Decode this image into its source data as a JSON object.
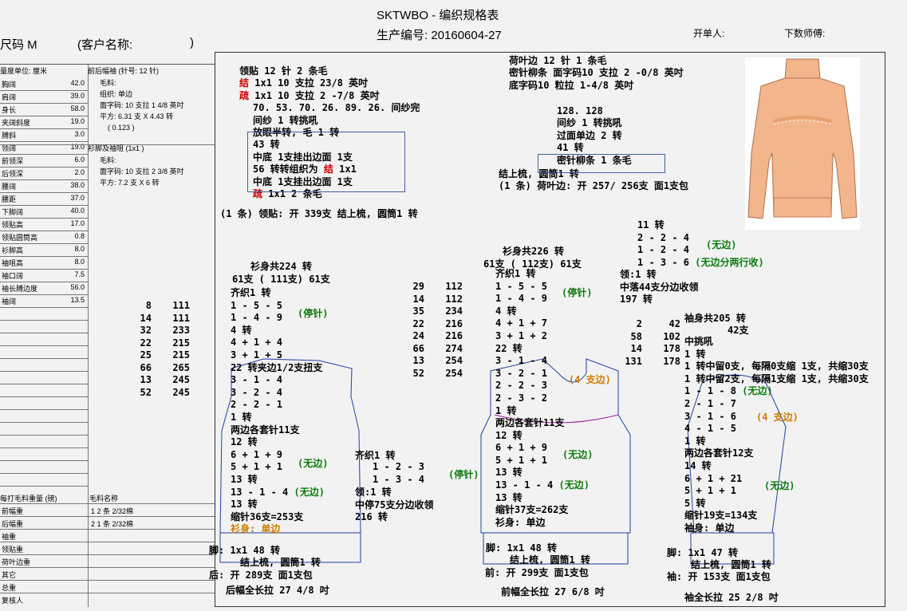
{
  "header": {
    "title": "SKTWBO - 编织规格表",
    "production_no": "生产编号: 20160604-27",
    "size": "尺码  M",
    "client": "(客户名称:",
    "client_close": ")",
    "issuer": "开单人:",
    "master": "下数师傅:"
  },
  "left": {
    "unit": "量度单位: 厘米",
    "measures": [
      {
        "k": "胸阔",
        "v": "42.0"
      },
      {
        "k": "肩阔",
        "v": "39.0"
      },
      {
        "k": "身长",
        "v": "58.0"
      },
      {
        "k": "夹阔斜度",
        "v": "19.0"
      },
      {
        "k": "膊斜",
        "v": "3.0"
      },
      {
        "k": "领阔",
        "v": "19.0"
      },
      {
        "k": "前领深",
        "v": "6.0"
      },
      {
        "k": "后领深",
        "v": "2.0"
      },
      {
        "k": "腰阔",
        "v": "38.0"
      },
      {
        "k": "腰距",
        "v": "37.0"
      },
      {
        "k": "下脚阔",
        "v": "40.0"
      },
      {
        "k": "领贴高",
        "v": "17.0"
      },
      {
        "k": "领贴圆筒高",
        "v": "0.8"
      },
      {
        "k": "衫脚高",
        "v": "8.0"
      },
      {
        "k": "袖咀高",
        "v": "8.0"
      },
      {
        "k": "袖口阔",
        "v": "7.5"
      },
      {
        "k": "袖长膊边度",
        "v": "56.0"
      },
      {
        "k": "袖阔",
        "v": "13.5"
      }
    ],
    "spec1_title": "前后幅袖 (针号: 12 针)",
    "spec1_lines": [
      "毛料:",
      "组织: 单边",
      "面字码: 10 支拉 1 4/8 英吋",
      "平方: 6.31 支 X 4.43 转",
      "( 0.123 )"
    ],
    "spec2_title": "衫脚及袖咀 (1x1 )",
    "spec2_lines": [
      "毛料:",
      "面字码: 10 支拉 2 3/8 英吋",
      "平方: 7.2 支 X 6 转"
    ],
    "weight_header": "每打毛料重量 (磅)",
    "material_header": "毛料名称",
    "weights": [
      {
        "k": "前幅重",
        "m": "1  2 条 2/32棉"
      },
      {
        "k": "后幅重",
        "m": "2  1 条 2/32棉"
      },
      {
        "k": "袖重",
        "m": ""
      },
      {
        "k": "领贴重",
        "m": ""
      },
      {
        "k": "荷叶边重",
        "m": ""
      },
      {
        "k": "其它",
        "m": ""
      },
      {
        "k": "总重",
        "m": ""
      },
      {
        "k": "复核人",
        "m": ""
      }
    ],
    "count_table": [
      [
        "8",
        "111"
      ],
      [
        "14",
        "111"
      ],
      [
        "32",
        "233"
      ],
      [
        "22",
        "215"
      ],
      [
        "25",
        "215"
      ],
      [
        "66",
        "265"
      ],
      [
        "13",
        "245"
      ],
      [
        "52",
        "245"
      ]
    ]
  },
  "collar": {
    "l1": "领贴   12  针  2  条毛",
    "l2a": "结",
    "l2b": " 1x1     10  支拉  23/8  英吋",
    "l3a": "疏",
    "l3b": " 1x1     10  支拉  2 -7/8  英吋",
    "l4": "70. 53. 70. 26. 89. 26.  间纱完",
    "l5": "间纱 1 转挑吼",
    "l6": "放眼半转,  毛 1 转",
    "l7": "43  转",
    "l8": "中底  1支挂出边面  1支",
    "l9a": "56  转转组织为 ",
    "l9b": "结",
    "l9c": "  1x1",
    "l10": "中底  1支挂出边面  1支",
    "l11a": "疏",
    "l11b": "  1x1     2  条毛",
    "l12": "(1 条)  领贴:  开  339支  结上梳,  圆筒1  转"
  },
  "ruffle": {
    "l1": "荷叶边   12  针  1  条毛",
    "l2": "密针柳条  面字码10  支拉  2 -0/8  英吋",
    "l3": "底字码10  粒拉  1-4/8 英吋",
    "l4": "128. 128",
    "l5": "间纱 1 转挑吼",
    "l6": "过面单边 2 转",
    "l7": "41  转",
    "l8": "密针柳条  1  条毛",
    "l9": "结上梳,  圆筒1  转",
    "l10": "(1  条)  荷叶边:  开  257/  256支  面1支包"
  },
  "back": {
    "title": "衫身共224  转",
    "split": "61支 (  111支) 61支",
    "q": "齐织1  转",
    "a1": "1 - 5 - 5",
    "a2": "1 - 4 - 9",
    "stop": "(停针)",
    "a3": "4  转",
    "a4": "4 + 1 + 4",
    "a5": "3 + 1 + 5",
    "a6": "22  转夹边1/2支扭支",
    "a7": "3 - 1 - 4",
    "a8": "3 - 2 - 4",
    "a9": "2 - 2 - 1",
    "a10": "1  转",
    "a11": "两边各套针11支",
    "a12": "12  转",
    "a13": "6 + 1 + 9",
    "a14": "5 + 1 + 1",
    "nobind": "(无边)",
    "a15": "13  转",
    "a16": "13  -  1  -  4",
    "a17": "13  转",
    "a18": "缩针36支=253支",
    "a19": "衫身:  单边",
    "a20": "脚:  1x1      48  转",
    "a21": "结上梳,  圆筒1  转",
    "a22": "后:  开  289支  面1支包",
    "a23": "后幅全长拉  27  4/8  吋"
  },
  "mid_table": [
    [
      "29",
      "112"
    ],
    [
      "14",
      "112"
    ],
    [
      "35",
      "234"
    ],
    [
      "22",
      "216"
    ],
    [
      "24",
      "216"
    ],
    [
      "66",
      "274"
    ],
    [
      "13",
      "254"
    ],
    [
      "52",
      "254"
    ]
  ],
  "mid": {
    "q": "齐织1  转",
    "b1": "1 - 2 - 3",
    "b2": "1 - 3 - 4",
    "stop": "(停针)",
    "c1": "领:1  转",
    "c2": "中停75支分边收领",
    "c3": "216  转"
  },
  "front": {
    "title": "衫身共226  转",
    "split": "61支 ( 112支) 61支",
    "q": "齐织1  转",
    "a1": "1 - 5 - 5",
    "a2": "1 - 4 - 9",
    "stop": "(停针)",
    "a3": "4  转",
    "a4": "4 + 1 + 7",
    "a5": "3 + 1 + 2",
    "a6": "22  转",
    "a7": "3 - 1 - 4",
    "a8": "3 - 2 - 1",
    "a9": "2 - 2 - 3",
    "a10": "2 - 3 - 2",
    "edge4": "(4  支边)",
    "a11": "1  转",
    "a12": "两边各套针11支",
    "a13": "12  转",
    "a14": "6 + 1 + 9",
    "a15": "5 + 1 + 1",
    "nobind": "(无边)",
    "a16": "13  转",
    "a17": "13  -  1  -  4",
    "a18": "13  转",
    "a19": "缩针37支=262支",
    "a20": "衫身:  单边",
    "a21": "脚:  1x1      48  转",
    "a22": "结上梳,  圆筒1  转",
    "a23": "前:  开  299支  面1支包",
    "a24": "前幅全长拉  27  6/8  吋",
    "neck_t": [
      [
        "2",
        "42"
      ],
      [
        "58",
        "102"
      ],
      [
        "14",
        "178"
      ],
      [
        "131",
        "178"
      ]
    ],
    "n1": "11  转",
    "n2": "2 - 2 - 4",
    "n3": "1 - 2 - 4",
    "n4": "1 - 3 - 6",
    "n_nb": "(无边)",
    "n_nb2": "(无边分两行收)",
    "n5": "领:1  转",
    "n6": "中落44支分边收领",
    "n7": "197  转"
  },
  "sleeve": {
    "title": "袖身共205  转",
    "s42": "42支",
    "s1": "中挑吼",
    "s2": "1  转",
    "s3": "1  转中留0支,  每隔0支缩  1支,  共缩30支",
    "s4": "1  转中留2支,  每隔1支缩  1支,  共缩30支",
    "s5": "1 - 1 - 8",
    "s6": "2 - 1 - 7",
    "s7": "3 - 1 - 6",
    "s8": "4 - 1 - 5",
    "nb": "(无边)",
    "edge4": "(4  支边)",
    "s9": "1  转",
    "s10": "两边各套针12支",
    "s11": "14  转",
    "s12": "6 + 1 + 21",
    "s13": "5 + 1 + 1",
    "s14": "5  转",
    "s15": "缩针19支=134支",
    "s16": "袖身:  单边",
    "s17": "脚:  1x1      47  转",
    "s18": "结上梳,  圆筒1  转",
    "s19": "袖:  开  153支  面1支包",
    "s20": "袖全长拉  25  2/8  吋"
  },
  "colors": {
    "garment": "#f2b58c",
    "red": "#d00000",
    "green": "#0b7a0b",
    "orange": "#d07a00"
  }
}
